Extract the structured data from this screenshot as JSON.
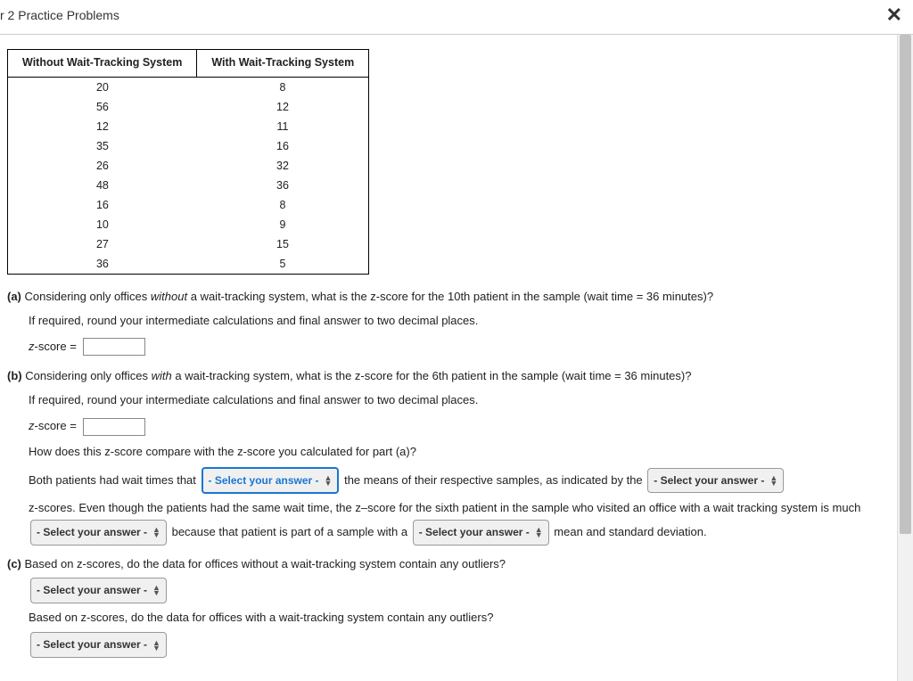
{
  "header": {
    "title": "r 2 Practice Problems"
  },
  "table": {
    "headers": [
      "Without Wait-Tracking System",
      "With Wait-Tracking System"
    ],
    "rows": [
      [
        "20",
        "8"
      ],
      [
        "56",
        "12"
      ],
      [
        "12",
        "11"
      ],
      [
        "35",
        "16"
      ],
      [
        "26",
        "32"
      ],
      [
        "48",
        "36"
      ],
      [
        "16",
        "8"
      ],
      [
        "10",
        "9"
      ],
      [
        "27",
        "15"
      ],
      [
        "36",
        "5"
      ]
    ]
  },
  "parts": {
    "a": {
      "label": "(a)",
      "q1_pre": " Considering only offices ",
      "q1_italic": "without",
      "q1_post": " a wait-tracking system, what is the z-score for the 10th patient in the sample (wait time = 36 minutes)?",
      "hint": "If required, round your intermediate calculations and final answer to two decimal places.",
      "zscore_label": "z-score ="
    },
    "b": {
      "label": "(b)",
      "q1_pre": " Considering only offices ",
      "q1_italic": "with",
      "q1_post": " a wait-tracking system, what is the z-score for the 6th patient in the sample (wait time = 36 minutes)?",
      "hint": "If required, round your intermediate calculations and final answer to two decimal places.",
      "zscore_label": "z-score =",
      "compare_q": "How does this z-score compare with the z-score you calculated for part (a)?",
      "para1_a": "Both patients had wait times that ",
      "para1_b": " the means of their respective samples, as indicated by the ",
      "para2_a": "z-scores. Even though the patients had the same wait time, the z–score for the sixth patient in the sample who visited an office with a wait tracking system is much ",
      "para2_b": " because that patient is part of a sample with a ",
      "para2_c": " mean and standard deviation."
    },
    "c": {
      "label": "(c)",
      "q1": " Based on z-scores, do the data for offices without a wait-tracking system contain any outliers?",
      "q2": "Based on z-scores, do the data for offices with a wait-tracking system contain any outliers?"
    }
  },
  "select": {
    "placeholder": "- Select your answer -"
  }
}
